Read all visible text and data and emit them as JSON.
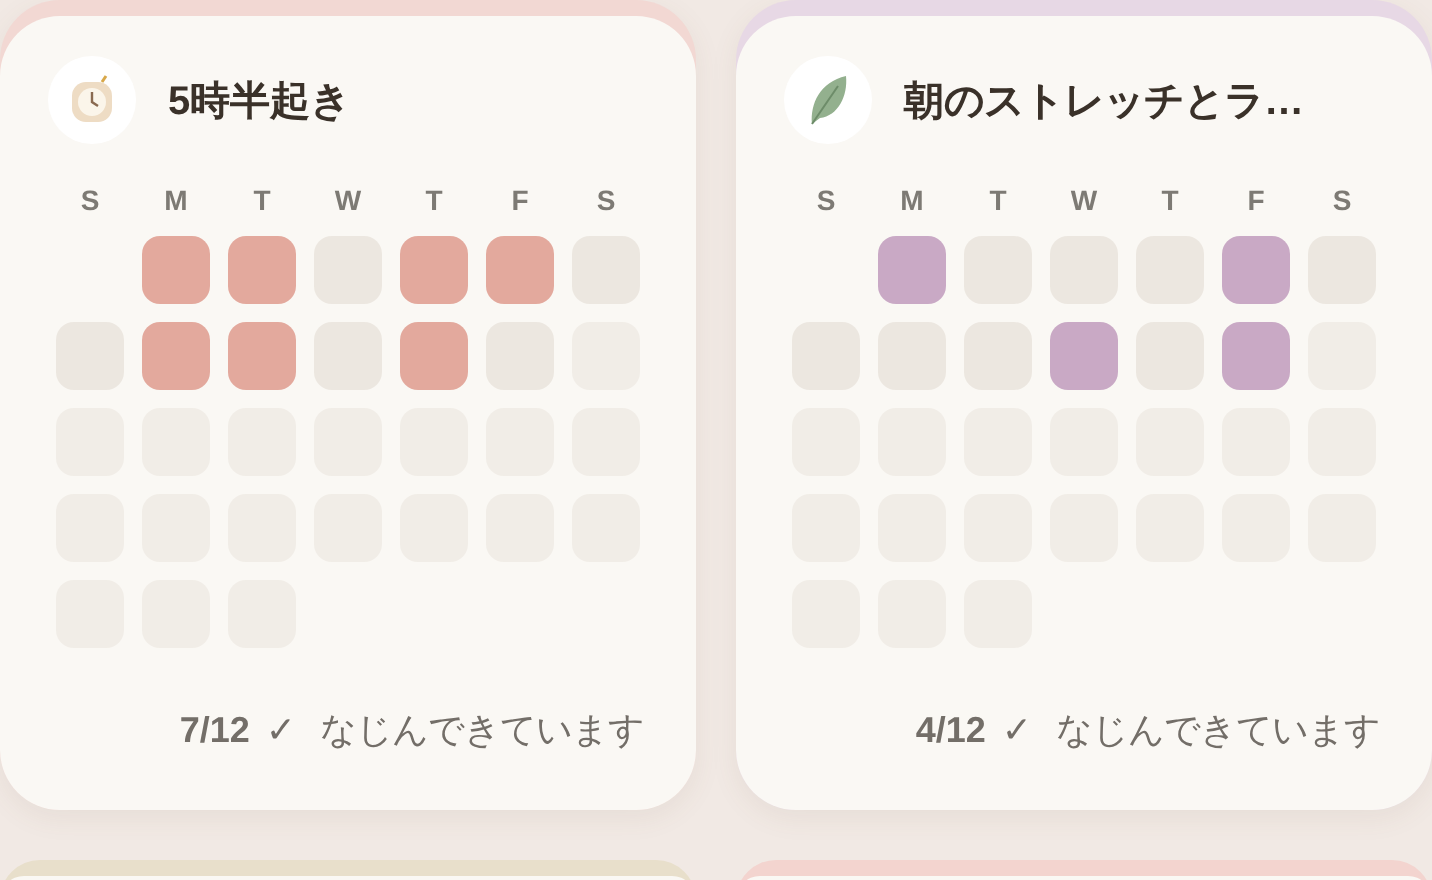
{
  "habits": [
    {
      "title": "5時半起き",
      "color": "#e3a99d",
      "weekdays": [
        "S",
        "M",
        "T",
        "W",
        "T",
        "F",
        "S"
      ],
      "weeks": [
        [
          {
            "kind": "blank"
          },
          {
            "kind": "done"
          },
          {
            "kind": "done"
          },
          {
            "kind": "missed"
          },
          {
            "kind": "done"
          },
          {
            "kind": "done"
          },
          {
            "kind": "missed"
          }
        ],
        [
          {
            "kind": "missed"
          },
          {
            "kind": "done"
          },
          {
            "kind": "done"
          },
          {
            "kind": "missed"
          },
          {
            "kind": "done"
          },
          {
            "kind": "missed"
          },
          {
            "kind": "future"
          }
        ],
        [
          {
            "kind": "future"
          },
          {
            "kind": "future"
          },
          {
            "kind": "future"
          },
          {
            "kind": "future"
          },
          {
            "kind": "future"
          },
          {
            "kind": "future"
          },
          {
            "kind": "future"
          }
        ],
        [
          {
            "kind": "future"
          },
          {
            "kind": "future"
          },
          {
            "kind": "future"
          },
          {
            "kind": "future"
          },
          {
            "kind": "future"
          },
          {
            "kind": "future"
          },
          {
            "kind": "future"
          }
        ],
        [
          {
            "kind": "future"
          },
          {
            "kind": "future"
          },
          {
            "kind": "future"
          }
        ]
      ],
      "count": "7/12",
      "check": "✓",
      "message": "なじんできています"
    },
    {
      "title": "朝のストレッチとラ…",
      "color": "#c9a9c5",
      "weekdays": [
        "S",
        "M",
        "T",
        "W",
        "T",
        "F",
        "S"
      ],
      "weeks": [
        [
          {
            "kind": "blank"
          },
          {
            "kind": "done"
          },
          {
            "kind": "missed"
          },
          {
            "kind": "missed"
          },
          {
            "kind": "missed"
          },
          {
            "kind": "done"
          },
          {
            "kind": "missed"
          }
        ],
        [
          {
            "kind": "missed"
          },
          {
            "kind": "missed"
          },
          {
            "kind": "missed"
          },
          {
            "kind": "done"
          },
          {
            "kind": "missed"
          },
          {
            "kind": "done"
          },
          {
            "kind": "future"
          }
        ],
        [
          {
            "kind": "future"
          },
          {
            "kind": "future"
          },
          {
            "kind": "future"
          },
          {
            "kind": "future"
          },
          {
            "kind": "future"
          },
          {
            "kind": "future"
          },
          {
            "kind": "future"
          }
        ],
        [
          {
            "kind": "future"
          },
          {
            "kind": "future"
          },
          {
            "kind": "future"
          },
          {
            "kind": "future"
          },
          {
            "kind": "future"
          },
          {
            "kind": "future"
          },
          {
            "kind": "future"
          }
        ],
        [
          {
            "kind": "future"
          },
          {
            "kind": "future"
          },
          {
            "kind": "future"
          }
        ]
      ],
      "count": "4/12",
      "check": "✓",
      "message": "なじんできています"
    }
  ],
  "next_cards": [
    {
      "color": "#e8dfcb"
    },
    {
      "color": "#f3d4cf"
    }
  ]
}
